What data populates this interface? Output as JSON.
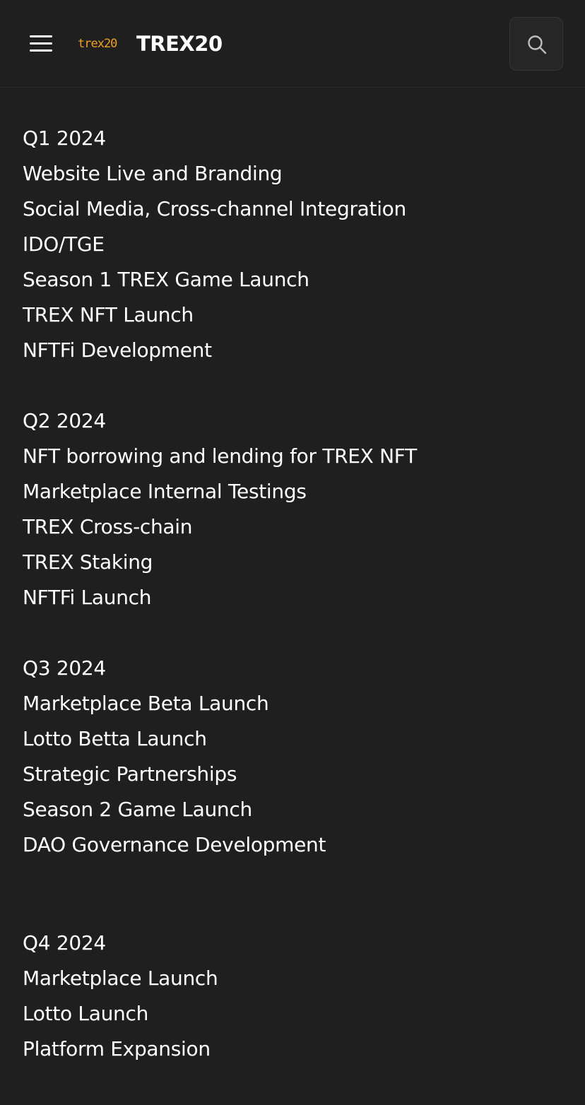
{
  "header": {
    "logo_text": "trex20",
    "brand_title": "TREX20",
    "menu_icon": "hamburger-menu-icon",
    "search_icon": "search-icon"
  },
  "roadmap": [
    {
      "quarter": "Q1 2024",
      "items": [
        "Website Live and Branding",
        "Social Media, Cross-channel Integration",
        "IDO/TGE",
        "Season 1 TREX Game Launch",
        "TREX NFT Launch",
        "NFTFi Development"
      ]
    },
    {
      "quarter": "Q2 2024",
      "items": [
        "NFT borrowing and lending for TREX NFT",
        "Marketplace Internal Testings",
        "TREX Cross-chain",
        "TREX Staking",
        "NFTFi Launch"
      ]
    },
    {
      "quarter": "Q3 2024",
      "items": [
        "Marketplace Beta Launch",
        "Lotto Betta Launch",
        "Strategic Partnerships",
        "Season 2 Game Launch",
        "DAO Governance Development"
      ]
    },
    {
      "quarter": "Q4 2024",
      "items": [
        "Marketplace Launch",
        "Lotto Launch",
        "Platform Expansion"
      ]
    }
  ],
  "colors": {
    "background": "#1f1f1f",
    "text": "#ffffff",
    "logo_accent": "#f0a020"
  }
}
